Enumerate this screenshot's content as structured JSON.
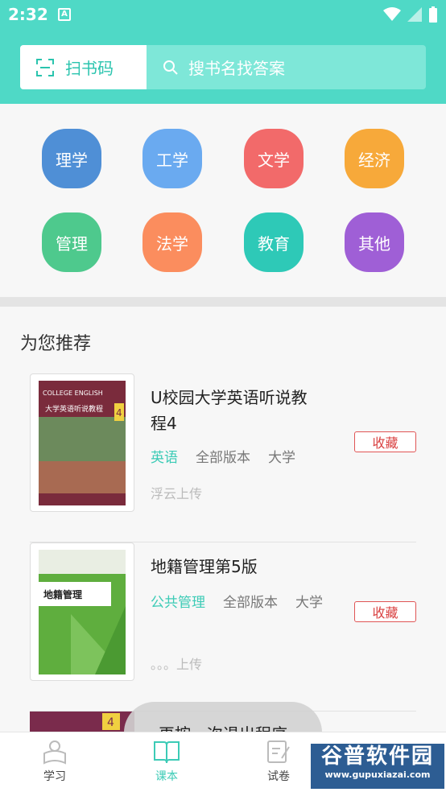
{
  "status": {
    "time": "2:32",
    "notif_letter": "A"
  },
  "header": {
    "scan_label": "扫书码",
    "search_placeholder": "搜书名找答案"
  },
  "categories": [
    {
      "label": "理学",
      "color": "#4f8fd6"
    },
    {
      "label": "工学",
      "color": "#6aaaf0"
    },
    {
      "label": "文学",
      "color": "#f26a6a"
    },
    {
      "label": "经济",
      "color": "#f7a93a"
    },
    {
      "label": "管理",
      "color": "#4ec98d"
    },
    {
      "label": "法学",
      "color": "#fb8d5e"
    },
    {
      "label": "教育",
      "color": "#2ec9b7"
    },
    {
      "label": "其他",
      "color": "#9f5fd6"
    }
  ],
  "recommend": {
    "title": "为您推荐",
    "books": [
      {
        "title": "U校园大学英语听说教程4",
        "subject": "英语",
        "version": "全部版本",
        "level": "大学",
        "uploader": "浮云上传",
        "fav": "收藏"
      },
      {
        "title": "地籍管理第5版",
        "subject": "公共管理",
        "version": "全部版本",
        "level": "大学",
        "uploader": "。。。上传",
        "fav": "收藏"
      }
    ],
    "cover_texts": {
      "book1": "大学英语听说教程",
      "book1_top": "COLLEGE ENGLISH",
      "book1_num": "4",
      "book2": "地籍管理",
      "book3_num": "4"
    }
  },
  "toast": "再按一次退出程序",
  "tabs": [
    {
      "label": "学习",
      "active": false
    },
    {
      "label": "课本",
      "active": true
    },
    {
      "label": "试卷",
      "active": false
    }
  ],
  "watermark": {
    "cn": "谷普软件园",
    "url": "www.gupuxiazai.com"
  },
  "colors": {
    "accent": "#4fd9c6",
    "fav_red": "#d94040"
  }
}
